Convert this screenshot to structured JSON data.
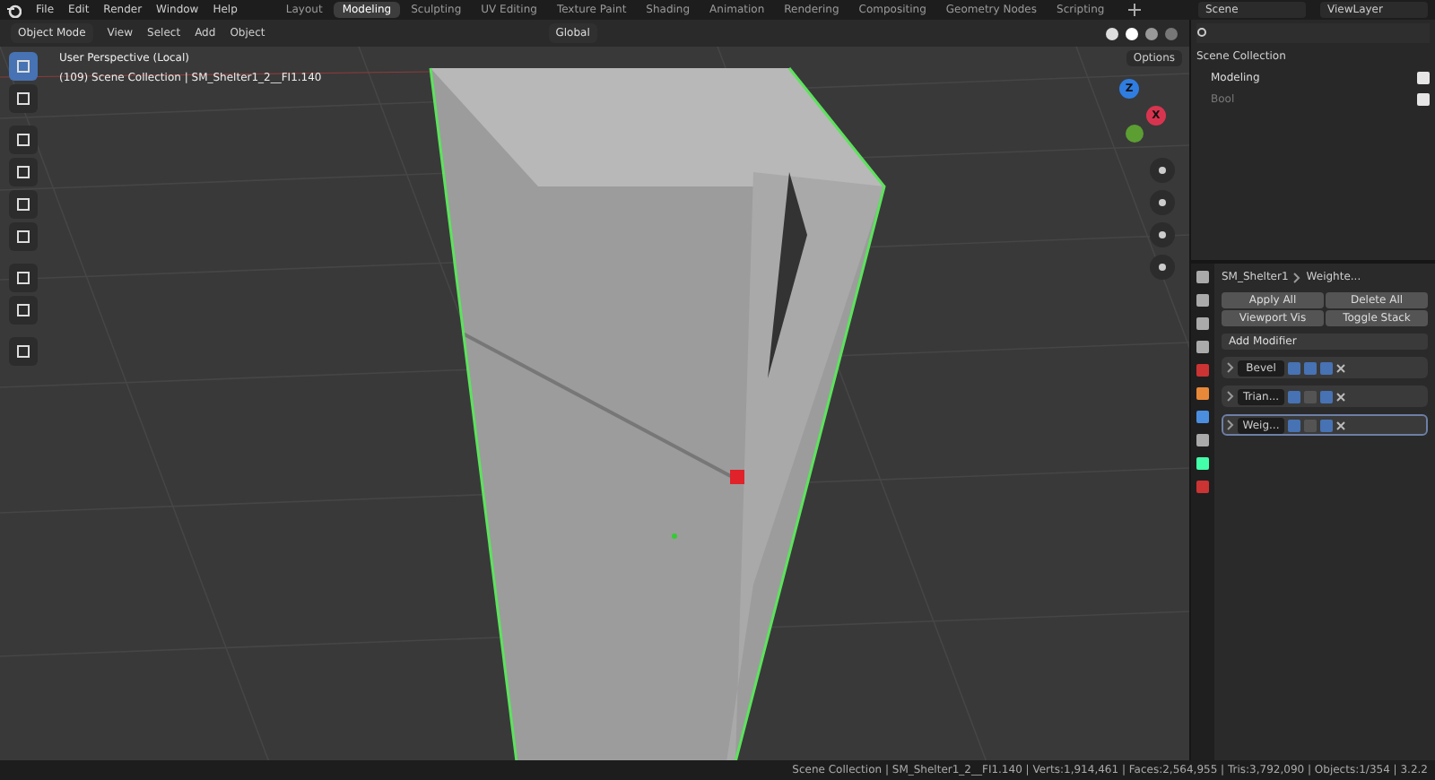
{
  "menu": [
    "File",
    "Edit",
    "Render",
    "Window",
    "Help"
  ],
  "workspaces": [
    {
      "label": "Layout",
      "selected": false
    },
    {
      "label": "Modeling",
      "selected": true
    },
    {
      "label": "Sculpting",
      "selected": false
    },
    {
      "label": "UV Editing",
      "selected": false
    },
    {
      "label": "Texture Paint",
      "selected": false
    },
    {
      "label": "Shading",
      "selected": false
    },
    {
      "label": "Animation",
      "selected": false
    },
    {
      "label": "Rendering",
      "selected": false
    },
    {
      "label": "Compositing",
      "selected": false
    },
    {
      "label": "Geometry Nodes",
      "selected": false
    },
    {
      "label": "Scripting",
      "selected": false
    }
  ],
  "scene": "Scene",
  "view_layer": "ViewLayer",
  "header": {
    "mode": "Object Mode",
    "menus": [
      "View",
      "Select",
      "Add",
      "Object"
    ],
    "orientation": "Global"
  },
  "viewport": {
    "perspective": "User Perspective (Local)",
    "collection": "(109) Scene Collection | SM_Shelter1_2__FI1.140",
    "options": "Options",
    "axes": [
      {
        "label": "Z",
        "color": "#2f7de1"
      },
      {
        "label": "X",
        "color": "#d9344f"
      }
    ]
  },
  "outliner": {
    "root": "Scene Collection",
    "items": [
      {
        "name": "Modeling",
        "enabled": true,
        "checked": true
      },
      {
        "name": "Bool",
        "enabled": false,
        "checked": true
      }
    ]
  },
  "properties": {
    "object": "SM_Shelter1",
    "modifier": "Weighte...",
    "buttons": [
      "Apply All",
      "Delete All",
      "Viewport Vis",
      "Toggle Stack"
    ],
    "add": "Add Modifier",
    "modifiers": [
      {
        "name": "Bevel",
        "selected": false,
        "viewport": true
      },
      {
        "name": "Trian...",
        "selected": false,
        "viewport": false
      },
      {
        "name": "Weig...",
        "selected": true,
        "viewport": false
      }
    ]
  },
  "status_bar": "Scene Collection | SM_Shelter1_2__FI1.140 | Verts:1,914,461 | Faces:2,564,955 | Tris:3,792,090 | Objects:1/354 | 3.2.2"
}
